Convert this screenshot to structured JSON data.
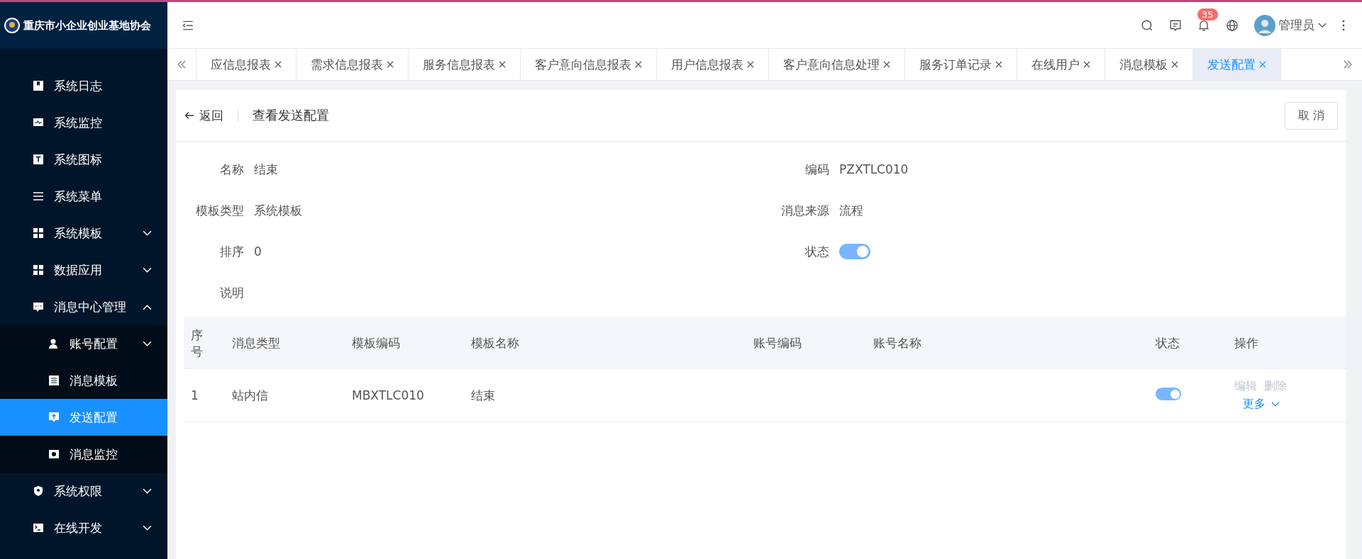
{
  "brand": {
    "title": "重庆市小企业创业基地协会"
  },
  "sidebar": {
    "items": [
      {
        "label": "系统日志",
        "kind": "link",
        "selected": false
      },
      {
        "label": "系统监控",
        "kind": "link",
        "selected": false
      },
      {
        "label": "系统图标",
        "kind": "link",
        "selected": false
      },
      {
        "label": "系统菜单",
        "kind": "link",
        "selected": false
      },
      {
        "label": "系统模板",
        "kind": "group",
        "expanded": false,
        "selected": false
      },
      {
        "label": "数据应用",
        "kind": "group",
        "expanded": false,
        "selected": false
      },
      {
        "label": "消息中心管理",
        "kind": "group",
        "expanded": true,
        "selected": false,
        "children": [
          {
            "label": "账号配置",
            "kind": "group",
            "expanded": false,
            "selected": false
          },
          {
            "label": "消息模板",
            "kind": "link",
            "selected": false
          },
          {
            "label": "发送配置",
            "kind": "link",
            "selected": true
          },
          {
            "label": "消息监控",
            "kind": "link",
            "selected": false
          }
        ]
      },
      {
        "label": "系统权限",
        "kind": "group",
        "expanded": false,
        "selected": false
      },
      {
        "label": "在线开发",
        "kind": "group",
        "expanded": false,
        "selected": false
      }
    ]
  },
  "header": {
    "notifications": "35",
    "user": "管理员"
  },
  "tabs": [
    {
      "label": "应信息报表",
      "selected": false
    },
    {
      "label": "需求信息报表",
      "selected": false
    },
    {
      "label": "服务信息报表",
      "selected": false
    },
    {
      "label": "客户意向信息报表",
      "selected": false
    },
    {
      "label": "用户信息报表",
      "selected": false
    },
    {
      "label": "客户意向信息处理",
      "selected": false
    },
    {
      "label": "服务订单记录",
      "selected": false
    },
    {
      "label": "在线用户",
      "selected": false
    },
    {
      "label": "消息模板",
      "selected": false
    },
    {
      "label": "发送配置",
      "selected": true
    }
  ],
  "page": {
    "back": "返回",
    "title": "查看发送配置",
    "cancel": "取 消"
  },
  "details": [
    {
      "label": "名称",
      "kind": "text",
      "value": "结束"
    },
    {
      "label": "编码",
      "kind": "text",
      "value": "PZXTLC010"
    },
    {
      "label": "模板类型",
      "kind": "text",
      "value": "系统模板"
    },
    {
      "label": "消息来源",
      "kind": "text",
      "value": "流程"
    },
    {
      "label": "排序",
      "kind": "text",
      "value": "0"
    },
    {
      "label": "状态",
      "kind": "switch",
      "on": true
    },
    {
      "label": "说明",
      "kind": "text"
    }
  ],
  "table": {
    "columns": [
      "序号",
      "消息类型",
      "模板编码",
      "模板名称",
      "账号编码",
      "账号名称",
      "状态",
      "操作"
    ],
    "rows": [
      {
        "index": "1",
        "message_type": "站内信",
        "template_code": "MBXTLC010",
        "template_name": "结束",
        "status_on": true,
        "actions": [
          {
            "label": "编辑",
            "disabled": true
          },
          {
            "label": "删除",
            "disabled": true
          }
        ],
        "more": "更多"
      }
    ]
  }
}
